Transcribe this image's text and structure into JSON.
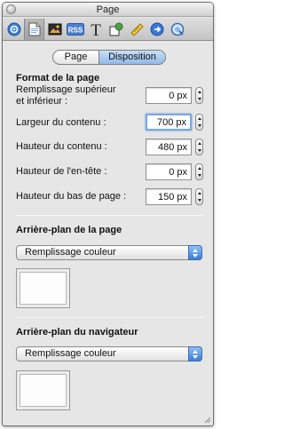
{
  "window": {
    "title": "Page"
  },
  "toolbar": {
    "buttons": [
      {
        "name": "inspector-icon",
        "active": false
      },
      {
        "name": "page-icon",
        "active": true
      },
      {
        "name": "layout-icon",
        "active": false
      },
      {
        "name": "rss-icon",
        "label": "RSS",
        "active": false
      },
      {
        "name": "text-icon",
        "label": "T",
        "active": false
      },
      {
        "name": "shapes-icon",
        "active": false
      },
      {
        "name": "ruler-icon",
        "active": false
      },
      {
        "name": "links-icon",
        "active": false
      },
      {
        "name": "quicktime-icon",
        "active": false
      }
    ]
  },
  "tabs": [
    {
      "label": "Page",
      "active": false
    },
    {
      "label": "Disposition",
      "active": true
    }
  ],
  "format": {
    "title": "Format de la page",
    "fields": [
      {
        "label_line1": "Remplissage supérieur",
        "label_line2": "et inférieur :",
        "value": "0 px",
        "focused": false
      },
      {
        "label_line1": "Largeur du contenu :",
        "label_line2": "",
        "value": "700 px",
        "focused": true
      },
      {
        "label_line1": "Hauteur du contenu :",
        "label_line2": "",
        "value": "480 px",
        "focused": false
      },
      {
        "label_line1": "Hauteur de l'en-tête :",
        "label_line2": "",
        "value": "0 px",
        "focused": false
      },
      {
        "label_line1": "Hauteur du bas de page :",
        "label_line2": "",
        "value": "150 px",
        "focused": false
      }
    ]
  },
  "page_background": {
    "title": "Arrière-plan de la page",
    "fill_type": "Remplissage couleur",
    "swatch_color": "#ffffff"
  },
  "browser_background": {
    "title": "Arrière-plan du navigateur",
    "fill_type": "Remplissage couleur",
    "swatch_color": "#ffffff"
  },
  "colors": {
    "accent": "#5e93db",
    "segment_active": "#a9c9f0",
    "window_bg": "#e6e6e6"
  }
}
